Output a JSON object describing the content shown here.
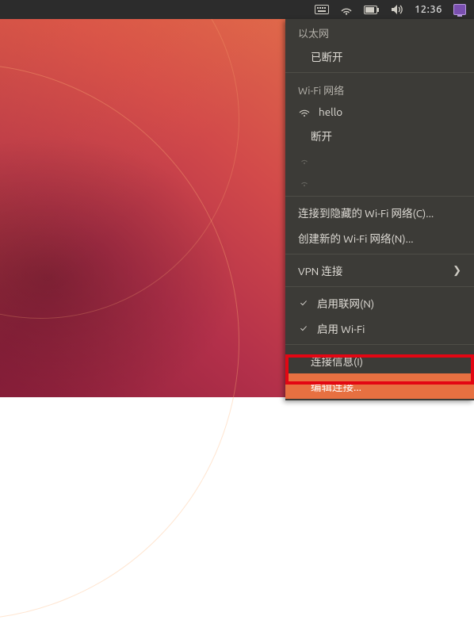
{
  "topbar": {
    "time": "12:36",
    "icons": [
      "keyboard",
      "network",
      "battery",
      "sound",
      "clock",
      "monitor"
    ]
  },
  "menu": {
    "ethernet_header": "以太网",
    "ethernet_disconnected": "已断开",
    "wifi_header": "Wi-Fi 网络",
    "wifi_network_1": "hello",
    "wifi_disconnect": "断开",
    "wifi_empty_1": "",
    "wifi_empty_2": "",
    "connect_hidden": "连接到隐藏的 Wi-Fi 网络(C)...",
    "create_new": "创建新的 Wi-Fi 网络(N)...",
    "vpn": "VPN 连接",
    "enable_networking": "启用联网(N)",
    "enable_wifi": "启用 Wi-Fi",
    "connection_info": "连接信息(I)",
    "edit_connections": "编辑连接..."
  },
  "checks": {
    "networking": true,
    "wifi": true
  }
}
